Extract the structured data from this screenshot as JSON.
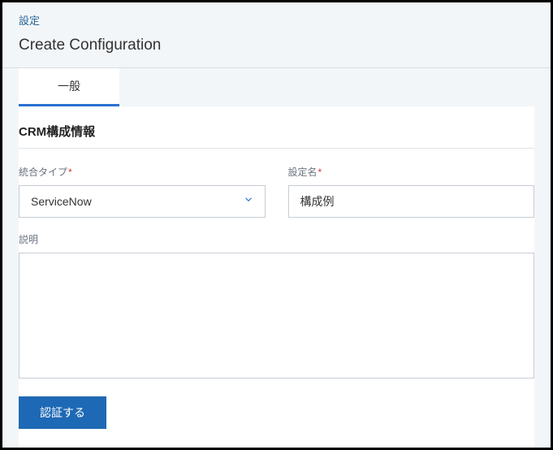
{
  "breadcrumb": {
    "label": "設定"
  },
  "page": {
    "title": "Create Configuration"
  },
  "tabs": [
    {
      "label": "一般"
    }
  ],
  "section": {
    "title": "CRM構成情報"
  },
  "form": {
    "integration_type": {
      "label": "統合タイプ",
      "value": "ServiceNow"
    },
    "config_name": {
      "label": "設定名",
      "value": "構成例"
    },
    "description": {
      "label": "説明",
      "value": ""
    }
  },
  "buttons": {
    "authenticate": "認証する"
  }
}
